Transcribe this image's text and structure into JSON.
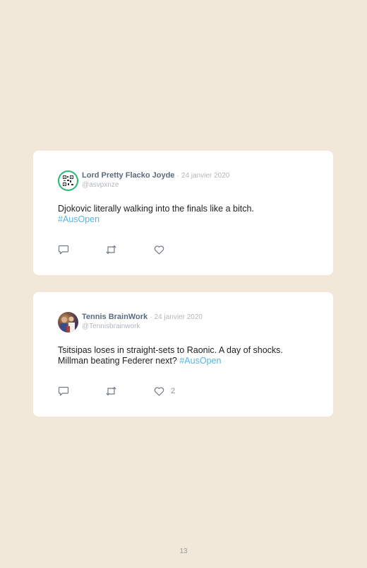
{
  "tweets": [
    {
      "display_name": "Lord Pretty Flacko Joyde",
      "separator": "·",
      "date": "24 janvier 2020",
      "handle": "@asvpxnze",
      "text": "Djokovic literally walking into the finals like a bitch.",
      "hashtag": "#AusOpen",
      "like_count": ""
    },
    {
      "display_name": "Tennis BrainWork",
      "separator": "·",
      "date": "24 janvier 2020",
      "handle": "@Tennisbrainwork",
      "text": "Tsitsipas loses in straight-sets to Raonic. A day of shocks. Millman beating Federer next?",
      "hashtag": "#AusOpen",
      "like_count": "2"
    }
  ],
  "icons": {
    "reply": "reply-icon",
    "retweet": "retweet-icon",
    "like": "heart-icon"
  },
  "colors": {
    "background": "#f2e8da",
    "card": "#ffffff",
    "hashtag": "#56b4e3",
    "name": "#5a6b7d",
    "muted": "#b3b8bd"
  },
  "page": {
    "number": "13"
  }
}
